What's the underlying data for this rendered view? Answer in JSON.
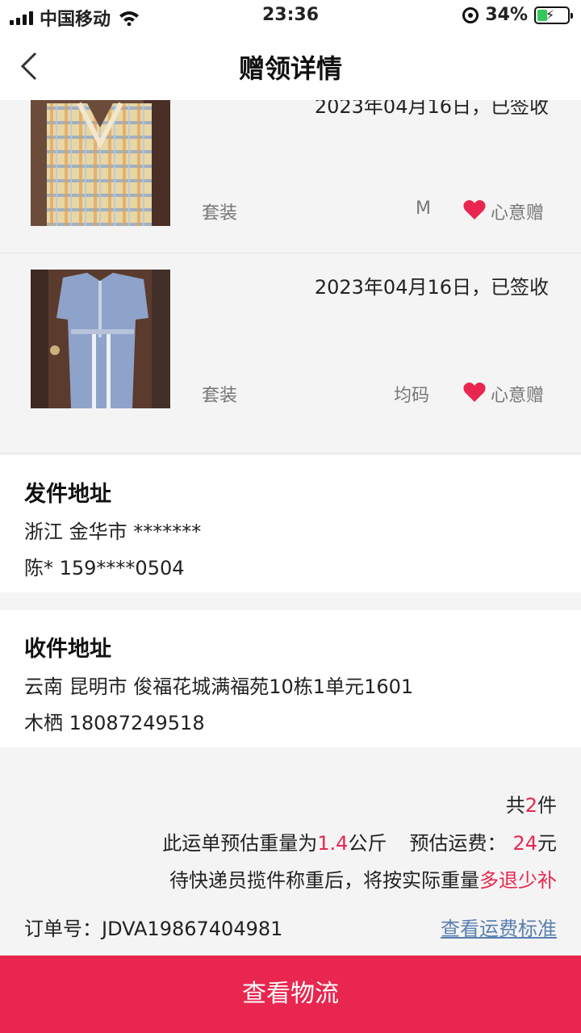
{
  "status_bar": {
    "carrier": "中国移动",
    "time": "23:36",
    "battery": "34%",
    "battery_level": 0.34
  },
  "nav": {
    "title": "赠领详情"
  },
  "items": [
    {
      "date": "2023年04月16日，已签收",
      "type": "套装",
      "size": "M",
      "tag": "心意赠"
    },
    {
      "date": "2023年04月16日，已签收",
      "type": "套装",
      "size": "均码",
      "tag": "心意赠"
    }
  ],
  "sender": {
    "title": "发件地址",
    "region": "浙江 金华市 *******",
    "contact": "陈* 159****0504"
  },
  "receiver": {
    "title": "收件地址",
    "region": "云南 昆明市 俊福花城满福苑10栋1单元1601",
    "contact": "木栖 18087249518"
  },
  "summary": {
    "count_prefix": "共",
    "count": "2",
    "count_suffix": "件",
    "weight_prefix": "此运单预估重量为",
    "weight": "1.4",
    "weight_unit": "公斤",
    "fee_label": "预估运费：",
    "fee": "24",
    "fee_unit": "元",
    "note_prefix": "待快递员揽件称重后，将按实际重量",
    "note_highlight": "多退少补",
    "order_label": "订单号：JDVA19867404981",
    "fee_standard_link": "查看运费标准"
  },
  "bottom_button": "查看物流",
  "colors": {
    "accent": "#e8264f",
    "link": "#5a7fb0",
    "battery": "#34c759"
  }
}
